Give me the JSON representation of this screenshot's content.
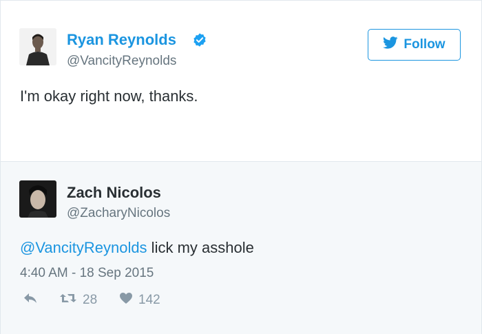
{
  "original_tweet": {
    "author_name": "Ryan Reynolds",
    "author_handle": "@VancityReynolds",
    "verified_icon": "verified-badge-icon",
    "text": "I'm okay right now, thanks.",
    "follow_label": "Follow",
    "follow_icon": "twitter-bird-icon"
  },
  "reply_tweet": {
    "author_name": "Zach Nicolos",
    "author_handle": "@ZacharyNicolos",
    "mention": "@VancityReynolds",
    "text_rest": " lick my asshole",
    "timestamp": "4:40 AM - 18 Sep 2015",
    "actions": {
      "reply_icon": "reply-icon",
      "retweet_icon": "retweet-icon",
      "retweet_count": "28",
      "like_icon": "heart-icon",
      "like_count": "142"
    }
  },
  "colors": {
    "twitter_blue": "#1b95e0",
    "text_primary": "#292f33",
    "text_secondary": "#66757f",
    "icon_gray": "#8899a6",
    "reply_background": "#f5f8fa"
  }
}
